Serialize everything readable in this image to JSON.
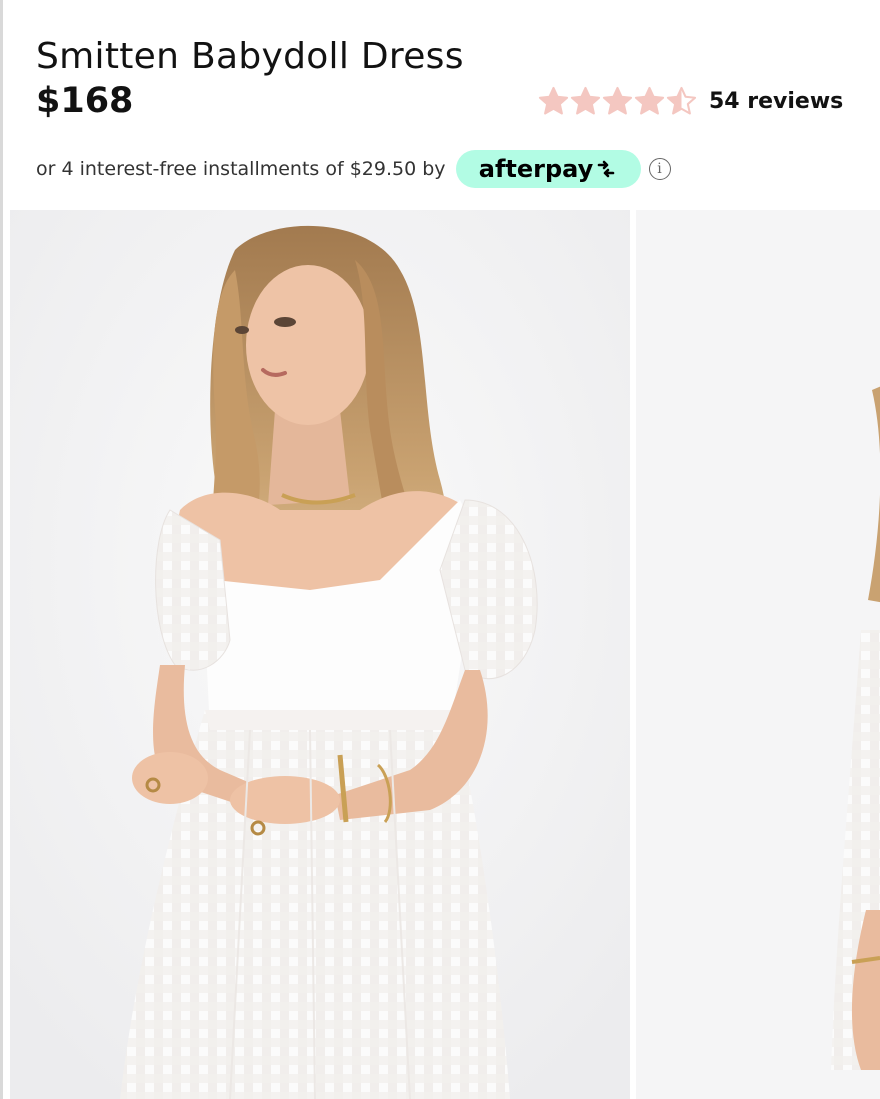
{
  "product": {
    "title": "Smitten Babydoll Dress",
    "price": "$168"
  },
  "rating": {
    "value": 4.5,
    "max": 5,
    "reviews_label": "54 reviews",
    "star_color": "#f4c7c1"
  },
  "payment": {
    "installments_text": "or 4 interest-free installments of $29.50 by",
    "afterpay_label": "afterpay",
    "afterpay_color": "#b2fce4",
    "info_icon": "info-icon",
    "info_symbol": "i"
  },
  "gallery": {
    "images": [
      {
        "name": "product-image-front",
        "icon": "model-photo"
      },
      {
        "name": "product-image-side",
        "icon": "model-photo"
      }
    ]
  }
}
